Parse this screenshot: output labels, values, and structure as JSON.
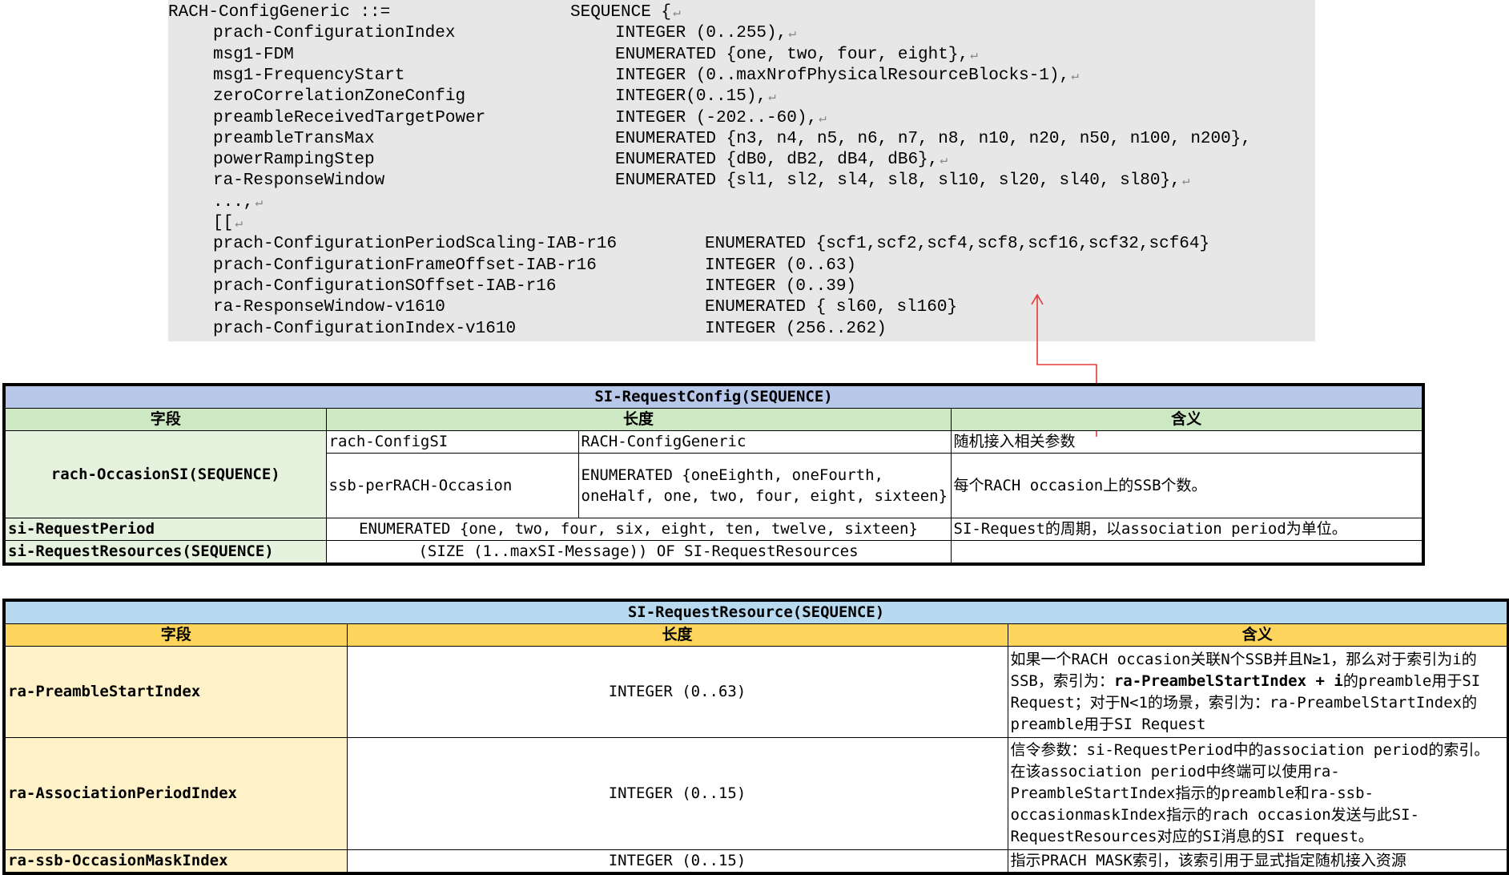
{
  "code": {
    "lines": [
      {
        "name": "RACH-ConfigGeneric ::=",
        "type": "SEQUENCE {",
        "ret": true
      },
      {
        "name": "prach-ConfigurationIndex",
        "type": "INTEGER (0..255),",
        "ret": true
      },
      {
        "name": "msg1-FDM",
        "type": "ENUMERATED {one, two, four, eight},",
        "ret": true
      },
      {
        "name": "msg1-FrequencyStart",
        "type": "INTEGER (0..maxNrofPhysicalResourceBlocks-1),",
        "ret": true
      },
      {
        "name": "zeroCorrelationZoneConfig",
        "type": "INTEGER(0..15),",
        "ret": true
      },
      {
        "name": "preambleReceivedTargetPower",
        "type": "INTEGER (-202..-60),",
        "ret": true
      },
      {
        "name": "preambleTransMax",
        "type": "ENUMERATED {n3, n4, n5, n6, n7, n8, n10, n20, n50, n100, n200},",
        "ret": false
      },
      {
        "name": "powerRampingStep",
        "type": "ENUMERATED {dB0, dB2, dB4, dB6},",
        "ret": true
      },
      {
        "name": "ra-ResponseWindow",
        "type": "ENUMERATED {sl1, sl2, sl4, sl8, sl10, sl20, sl40, sl80},",
        "ret": true
      },
      {
        "name": "...,",
        "type": "",
        "ret": true
      },
      {
        "name": "[[",
        "type": "",
        "ret": true
      },
      {
        "name": "prach-ConfigurationPeriodScaling-IAB-r16",
        "type": "ENUMERATED {scf1,scf2,scf4,scf8,scf16,scf32,scf64}",
        "ret": false
      },
      {
        "name": "prach-ConfigurationFrameOffset-IAB-r16",
        "type": "INTEGER (0..63)",
        "ret": false
      },
      {
        "name": "prach-ConfigurationSOffset-IAB-r16",
        "type": "INTEGER (0..39)",
        "ret": false
      },
      {
        "name": "ra-ResponseWindow-v1610",
        "type": "ENUMERATED { sl60, sl160}",
        "ret": false
      },
      {
        "name": "prach-ConfigurationIndex-v1610",
        "type": "INTEGER (256..262)",
        "ret": false
      }
    ],
    "return_glyph": "↵"
  },
  "table1": {
    "title": "SI-RequestConfig(SEQUENCE)",
    "headers": [
      "字段",
      "长度",
      "含义"
    ],
    "rach_field": "rach-OccasionSI(SEQUENCE)",
    "sub1_name": "rach-ConfigSI",
    "sub1_len": "RACH-ConfigGeneric",
    "sub1_desc": "随机接入相关参数",
    "sub2_name": "ssb-perRACH-Occasion",
    "sub2_len": "ENUMERATED {oneEighth, oneFourth, oneHalf, one, two, four, eight, sixteen}",
    "sub2_desc": "每个RACH occasion上的SSB个数。",
    "row3_field": "si-RequestPeriod",
    "row3_len": "ENUMERATED {one, two, four, six, eight, ten, twelve, sixteen}",
    "row3_desc": "SI-Request的周期，以association period为单位。",
    "row4_field": "si-RequestResources(SEQUENCE)",
    "row4_len": "(SIZE (1..maxSI-Message)) OF SI-RequestResources",
    "row4_desc": ""
  },
  "table2": {
    "title": "SI-RequestResource(SEQUENCE)",
    "headers": [
      "字段",
      "长度",
      "含义"
    ],
    "r1_field": "ra-PreambleStartIndex",
    "r1_len": "INTEGER (0..63)",
    "r1_desc_a": "如果一个RACH occasion关联N个SSB并且N≥1，那么对于索引为i的SSB，索引为：",
    "r1_desc_b": "ra-PreambelStartIndex + i",
    "r1_desc_c": "的preamble用于SI Request；对于N<1的场景，索引为：ra-PreambelStartIndex的preamble用于SI Request",
    "r2_field": "ra-AssociationPeriodIndex",
    "r2_len": "INTEGER (0..15)",
    "r2_desc": "信令参数：si-RequestPeriod中的association period的索引。在该association period中终端可以使用ra-PreambleStartIndex指示的preamble和ra-ssb-occasionmaskIndex指示的rach occasion发送与此SI-RequestResources对应的SI消息的SI request。",
    "r3_field": "ra-ssb-OccasionMaskIndex",
    "r3_len": "INTEGER (0..15)",
    "r3_desc": "指示PRACH MASK索引，该索引用于显式指定随机接入资源"
  },
  "colors": {
    "arrow": "#e53935"
  }
}
